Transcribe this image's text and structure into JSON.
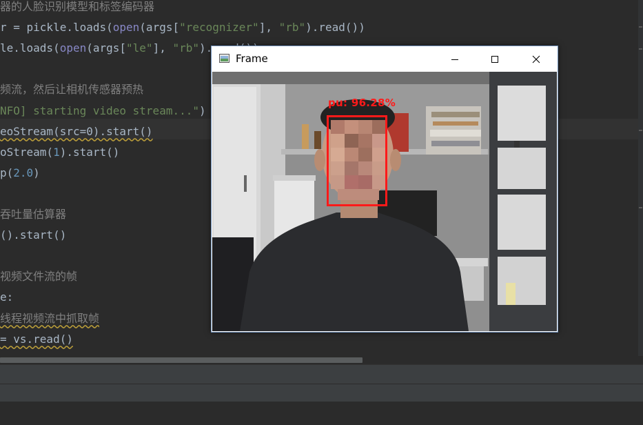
{
  "editor": {
    "lines": [
      {
        "parts": [
          {
            "t": "器的人脸识别模型和标签编码器",
            "c": "c-comment"
          }
        ],
        "cjk": true
      },
      {
        "parts": [
          {
            "t": "r = pickle.loads("
          },
          {
            "t": "open",
            "c": "c-builtin"
          },
          {
            "t": "(args["
          },
          {
            "t": "\"recognizer\"",
            "c": "c-string"
          },
          {
            "t": "], "
          },
          {
            "t": "\"rb\"",
            "c": "c-string"
          },
          {
            "t": ").read())"
          }
        ]
      },
      {
        "parts": [
          {
            "t": "le.loads("
          },
          {
            "t": "open",
            "c": "c-builtin"
          },
          {
            "t": "(args["
          },
          {
            "t": "\"le\"",
            "c": "c-string"
          },
          {
            "t": "], "
          },
          {
            "t": "\"rb\"",
            "c": "c-string"
          },
          {
            "t": ").read())"
          }
        ]
      },
      {
        "parts": []
      },
      {
        "parts": [
          {
            "t": "频流，然后让相机传感器预热",
            "c": "c-comment"
          }
        ],
        "cjk": true
      },
      {
        "parts": [
          {
            "t": "NFO] starting video stream...\"",
            "c": "c-string"
          },
          {
            "t": ")"
          }
        ]
      },
      {
        "parts": [
          {
            "t": "eoStream(src=0).start()",
            "c": "c-warn"
          }
        ]
      },
      {
        "parts": [
          {
            "t": "oStream("
          },
          {
            "t": "1",
            "c": "c-num"
          },
          {
            "t": ").start()"
          }
        ]
      },
      {
        "parts": [
          {
            "t": "p("
          },
          {
            "t": "2.0",
            "c": "c-num"
          },
          {
            "t": ")"
          }
        ]
      },
      {
        "parts": []
      },
      {
        "parts": [
          {
            "t": "吞吐量估算器",
            "c": "c-comment"
          }
        ],
        "cjk": true
      },
      {
        "parts": [
          {
            "t": "().start()"
          }
        ]
      },
      {
        "parts": []
      },
      {
        "parts": [
          {
            "t": "视频文件流的帧",
            "c": "c-comment"
          }
        ],
        "cjk": true
      },
      {
        "parts": [
          {
            "t": "e:"
          }
        ]
      },
      {
        "parts": [
          {
            "t": "线程视频流中抓取帧",
            "c": "c-comment c-warn"
          }
        ],
        "cjk": true
      },
      {
        "parts": [
          {
            "t": "= vs.read()",
            "c": "c-warn"
          }
        ]
      }
    ]
  },
  "frame_window": {
    "title": "Frame",
    "icons": {
      "app": "opencv-window-icon",
      "minimize": "minimize-icon",
      "maximize": "maximize-icon",
      "close": "close-icon"
    },
    "detection_label": "pu: 96.28%",
    "colors": {
      "box": "#ff1a1a",
      "titlebar": "#ffffff",
      "border": "#6e8fb8"
    }
  },
  "colors": {
    "editor_bg": "#2b2b2b",
    "text": "#a9b7c6",
    "comment": "#808080",
    "string": "#6a8759",
    "number": "#6897bb",
    "builtin": "#8888c6"
  }
}
